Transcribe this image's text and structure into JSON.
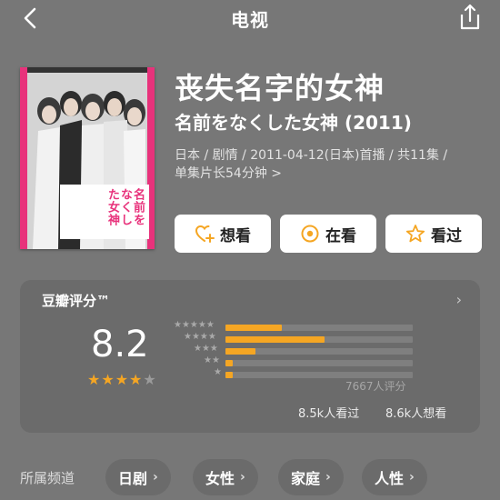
{
  "header": {
    "title": "电视"
  },
  "poster": {
    "text": "名前をなくした女神",
    "icon": "poster-image"
  },
  "show": {
    "title_cn": "丧失名字的女神",
    "title_jp": "名前をなくした女神 (2011)",
    "meta_line1": "日本 / 剧情 / 2011-04-12(日本)首播 / 共11集 /",
    "meta_line2": "单集片长54分钟 >"
  },
  "actions": [
    {
      "label": "想看",
      "icon": "heart-plus-icon"
    },
    {
      "label": "在看",
      "icon": "watching-icon"
    },
    {
      "label": "看过",
      "icon": "star-outline-icon"
    }
  ],
  "rating": {
    "title": "豆瓣评分™",
    "score": "8.2",
    "stars": {
      "filled": 4,
      "empty": 1
    },
    "distribution": [
      {
        "stars": 5,
        "fraction": 0.3
      },
      {
        "stars": 4,
        "fraction": 0.53
      },
      {
        "stars": 3,
        "fraction": 0.16
      },
      {
        "stars": 2,
        "fraction": 0.04
      },
      {
        "stars": 1,
        "fraction": 0.04
      }
    ],
    "count": "7667人评分",
    "seen": "8.5k人看过",
    "want": "8.6k人想看"
  },
  "channels": {
    "label": "所属频道",
    "tags": [
      "日剧",
      "女性",
      "家庭",
      "人性"
    ]
  },
  "colors": {
    "accent": "#f5a623",
    "background": "#777777",
    "card": "#6b6b6b",
    "poster_pink": "#e8327b"
  }
}
